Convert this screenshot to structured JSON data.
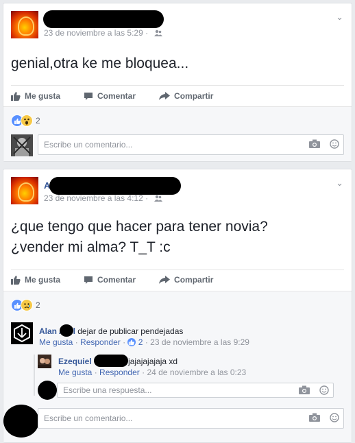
{
  "posts": [
    {
      "date": "23 de noviembre a las 5:29",
      "text": [
        "genial,otra ke me bloquea..."
      ],
      "actions": {
        "like": "Me gusta",
        "comment": "Comentar",
        "share": "Compartir"
      },
      "reaction_count": "2",
      "comment_placeholder": "Escribe un comentario..."
    },
    {
      "author_initial": "A",
      "date": "23 de noviembre a las 4:12",
      "text": [
        "¿que tengo que hacer para tener novia?",
        "¿vender mi alma? T_T :c"
      ],
      "actions": {
        "like": "Me gusta",
        "comment": "Comentar",
        "share": "Compartir"
      },
      "reaction_count": "2",
      "comments": [
        {
          "author": "Alan A",
          "author_tail": "l",
          "text": "dejar de publicar pendejadas",
          "like": "Me gusta",
          "reply": "Responder",
          "likes": "2",
          "date": "23 de noviembre a las 9:29",
          "replies": [
            {
              "author": "Ezequiel",
              "text": "jajajajajaja xd",
              "like": "Me gusta",
              "reply": "Responder",
              "date": "24 de noviembre a las 0:23"
            }
          ]
        }
      ],
      "reply_placeholder": "Escribe una respuesta...",
      "comment_placeholder": "Escribe un comentario..."
    }
  ],
  "separator": "·"
}
